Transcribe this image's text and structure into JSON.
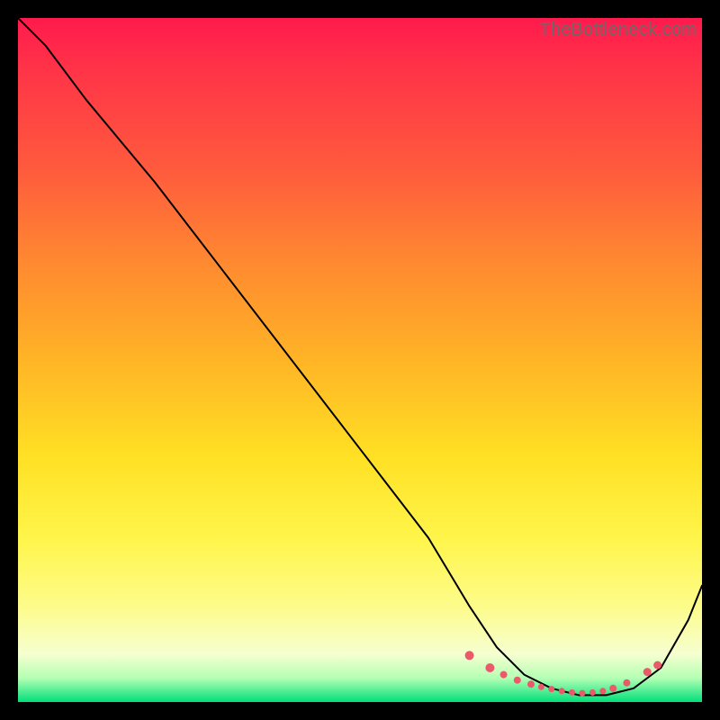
{
  "watermark": "TheBottleneck.com",
  "chart_data": {
    "type": "line",
    "title": "",
    "xlabel": "",
    "ylabel": "",
    "xlim": [
      0,
      100
    ],
    "ylim": [
      0,
      100
    ],
    "grid": false,
    "legend": false,
    "background_gradient": {
      "top": "#ff1a4d",
      "mid": "#ffe024",
      "bottom": "#00e07a"
    },
    "series": [
      {
        "name": "bottleneck-curve",
        "color": "#000000",
        "x": [
          0,
          4,
          10,
          20,
          30,
          40,
          50,
          60,
          66,
          70,
          74,
          78,
          82,
          86,
          90,
          94,
          98,
          100
        ],
        "y": [
          100,
          96,
          88,
          76,
          63,
          50,
          37,
          24,
          14,
          8,
          4,
          2,
          1,
          1,
          2,
          5,
          12,
          17
        ]
      }
    ],
    "markers": {
      "name": "flat-zone",
      "color": "#ea5a6a",
      "points": [
        {
          "x": 66,
          "y": 6.8,
          "r": 5
        },
        {
          "x": 69,
          "y": 5.0,
          "r": 5
        },
        {
          "x": 71,
          "y": 4.0,
          "r": 4
        },
        {
          "x": 73,
          "y": 3.2,
          "r": 4
        },
        {
          "x": 75,
          "y": 2.6,
          "r": 4
        },
        {
          "x": 76.5,
          "y": 2.2,
          "r": 3.5
        },
        {
          "x": 78,
          "y": 1.9,
          "r": 3.5
        },
        {
          "x": 79.5,
          "y": 1.6,
          "r": 3.5
        },
        {
          "x": 81,
          "y": 1.4,
          "r": 3.5
        },
        {
          "x": 82.5,
          "y": 1.3,
          "r": 3.5
        },
        {
          "x": 84,
          "y": 1.4,
          "r": 3.5
        },
        {
          "x": 85.5,
          "y": 1.6,
          "r": 3.5
        },
        {
          "x": 87,
          "y": 2.0,
          "r": 4
        },
        {
          "x": 89,
          "y": 2.8,
          "r": 4
        },
        {
          "x": 92,
          "y": 4.4,
          "r": 4.5
        },
        {
          "x": 93.5,
          "y": 5.4,
          "r": 4.5
        }
      ]
    }
  }
}
